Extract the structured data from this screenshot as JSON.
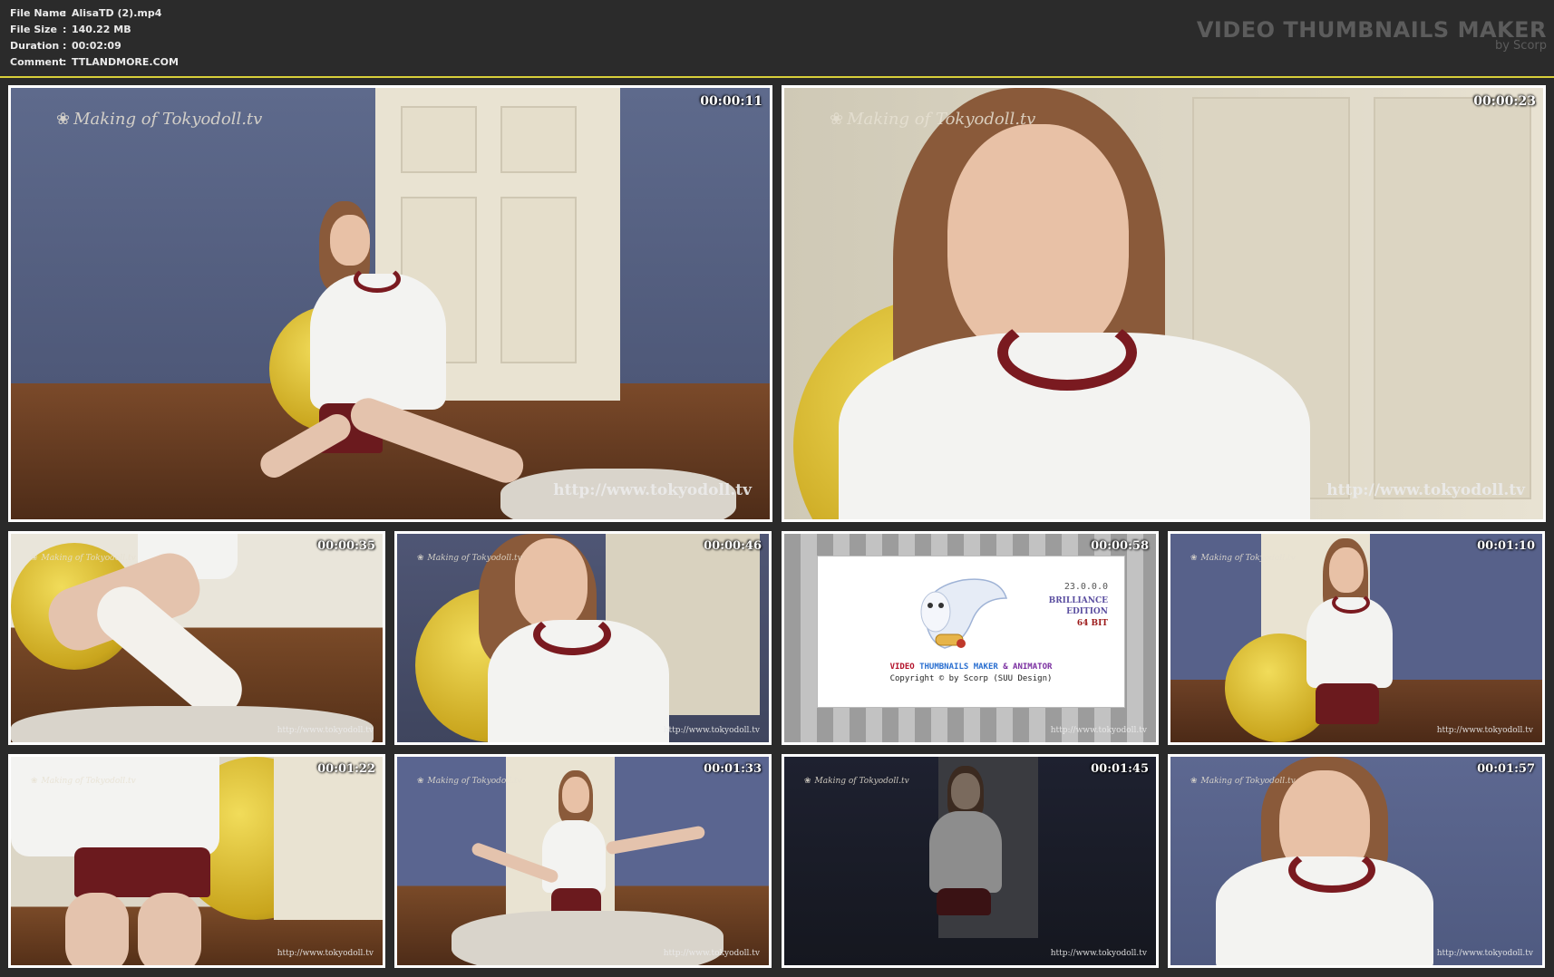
{
  "header": {
    "fields": [
      {
        "key": "File Name",
        "value": "AlisaTD (2).mp4"
      },
      {
        "key": "File Size",
        "value": "140.22 MB"
      },
      {
        "key": "Duration",
        "value": "00:02:09"
      },
      {
        "key": "Comment",
        "value": "TTLANDMORE.COM"
      }
    ],
    "separator": ":",
    "brand_title": "VIDEO THUMBNAILS MAKER",
    "brand_sub": "by Scorp"
  },
  "watermark": {
    "making": "Making of Tokyodoll.tv",
    "url": "http://www.tokyodoll.tv"
  },
  "thumbnails": [
    {
      "time": "00:00:11"
    },
    {
      "time": "00:00:23"
    },
    {
      "time": "00:00:35"
    },
    {
      "time": "00:00:46"
    },
    {
      "time": "00:00:58"
    },
    {
      "time": "00:01:10"
    },
    {
      "time": "00:01:22"
    },
    {
      "time": "00:01:33"
    },
    {
      "time": "00:01:45"
    },
    {
      "time": "00:01:57"
    }
  ],
  "splash": {
    "version": "23.0.0.0",
    "edition_line1": "BRILLIANCE",
    "edition_line2": "EDITION",
    "bits": "64 BIT",
    "title_part1": "VIDEO",
    "title_part2": "THUMBNAILS MAKER",
    "title_part3": "& ANIMATOR",
    "copyright": "Copyright © by Scorp (SUU Design)"
  },
  "colors": {
    "accent_line": "#d8cf3a",
    "frame_border": "#ffffff",
    "background": "#2a2a2a"
  }
}
